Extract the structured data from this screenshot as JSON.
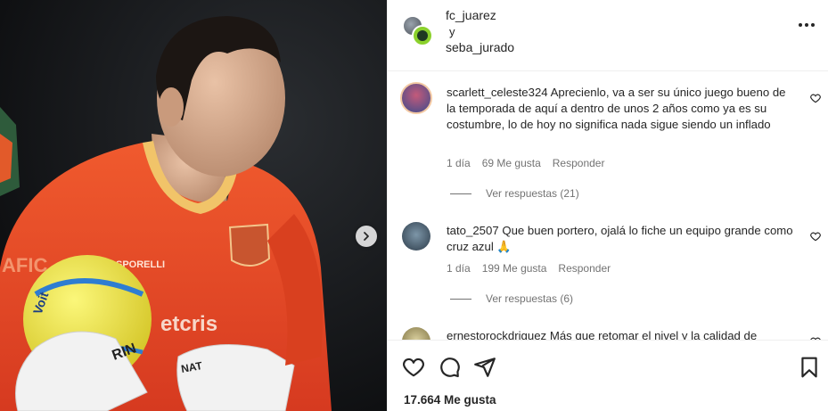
{
  "post": {
    "authors": [
      "fc_juarez",
      "seba_jurado"
    ],
    "and_word": "y",
    "likes": "17.664 Me gusta"
  },
  "photo": {
    "jersey_brand": "SPORELLI",
    "ball_text": "Voit",
    "glove_text_1": "RIN",
    "glove_text_2": "NAT",
    "sponsor": "etcris",
    "side_sponsor": "AFIC"
  },
  "comments": [
    {
      "username": "scarlett_celeste324",
      "text": "Aprecienlo, va a ser su único juego bueno de la temporada de aquí a dentro de unos 2 años como ya es su costumbre, lo de hoy no significa nada sigue siendo un inflado",
      "time": "1 día",
      "likes": "69 Me gusta",
      "reply": "Responder",
      "view_replies": "Ver respuestas (21)"
    },
    {
      "username": "tato_2507",
      "text": "Que buen portero, ojalá lo fiche un equipo grande como cruz azul 🙏",
      "time": "1 día",
      "likes": "199 Me gusta",
      "reply": "Responder",
      "view_replies": "Ver respuestas (6)"
    },
    {
      "username": "ernestorockdriguez",
      "text": "Más que retomar el nivel y la calidad de"
    }
  ],
  "icons": {
    "like": "heart-icon",
    "comment": "comment-icon",
    "share": "share-icon",
    "save": "bookmark-icon",
    "more": "more-icon",
    "next": "chevron-right-icon"
  },
  "colors": {
    "jersey": "#e8452a",
    "ball": "#f1e94a",
    "text": "#262626",
    "muted": "#737373"
  }
}
